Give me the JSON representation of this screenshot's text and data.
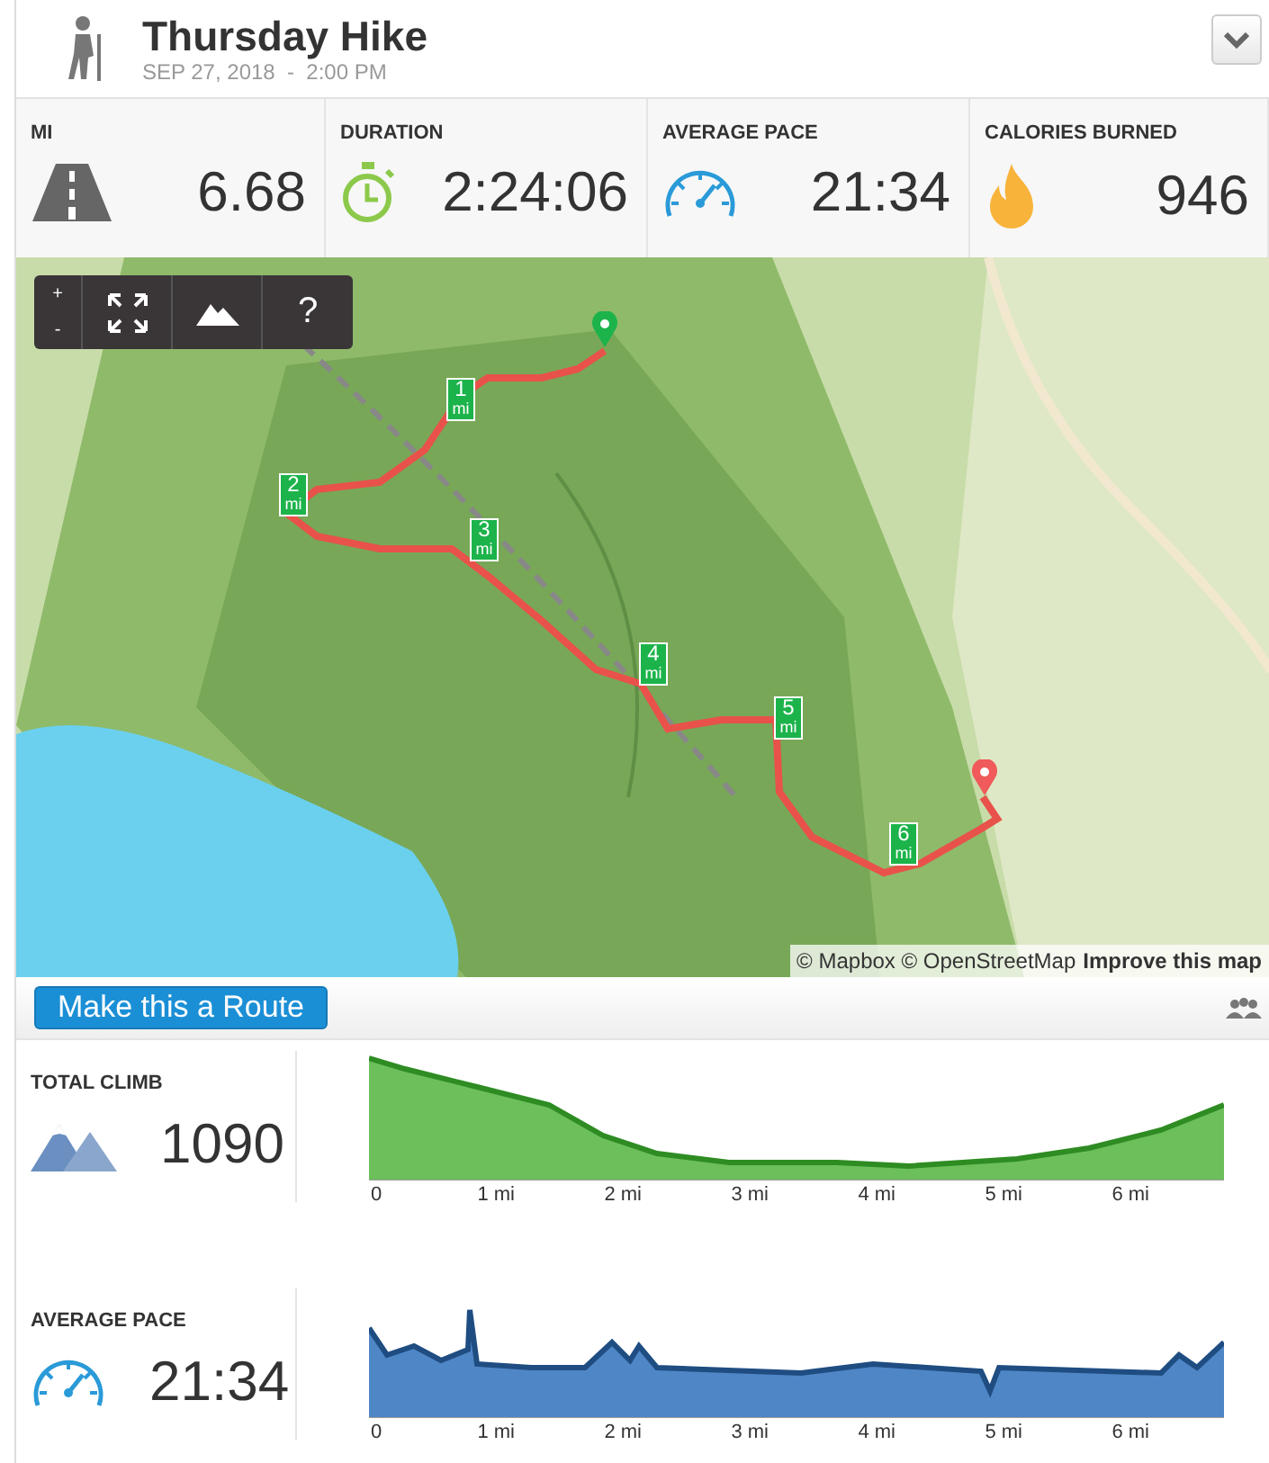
{
  "header": {
    "title": "Thursday Hike",
    "date": "SEP 27, 2018  -  2:00 PM"
  },
  "stats": [
    {
      "kind": "road",
      "label": "MI",
      "value": "6.68"
    },
    {
      "kind": "stopwatch",
      "label": "DURATION",
      "value": "2:24:06"
    },
    {
      "kind": "gauge",
      "label": "AVERAGE PACE",
      "value": "21:34"
    },
    {
      "kind": "flame",
      "label": "CALORIES BURNED",
      "value": "946"
    }
  ],
  "map": {
    "kind": "picture",
    "controls": [
      "+",
      "-",
      "?"
    ],
    "mile_markers": [
      {
        "number": "1",
        "unit": "mi"
      },
      {
        "number": "2",
        "unit": "mi"
      },
      {
        "number": "3",
        "unit": "mi"
      },
      {
        "number": "4",
        "unit": "mi"
      },
      {
        "number": "5",
        "unit": "mi"
      },
      {
        "number": "6",
        "unit": "mi"
      }
    ],
    "attribution": "© Mapbox © OpenStreetMap",
    "improve_link": "Improve this map"
  },
  "route_button": "Make this a Route",
  "charts": [
    {
      "kind": "climb",
      "label": "TOTAL CLIMB",
      "value": "1090",
      "x_labels": [
        "0",
        "1 mi",
        "2 mi",
        "3 mi",
        "4 mi",
        "5 mi",
        "6 mi"
      ]
    },
    {
      "kind": "pace",
      "label": "AVERAGE PACE",
      "value": "21:34",
      "x_labels": [
        "0",
        "1 mi",
        "2 mi",
        "3 mi",
        "4 mi",
        "5 mi",
        "6 mi"
      ]
    }
  ]
}
